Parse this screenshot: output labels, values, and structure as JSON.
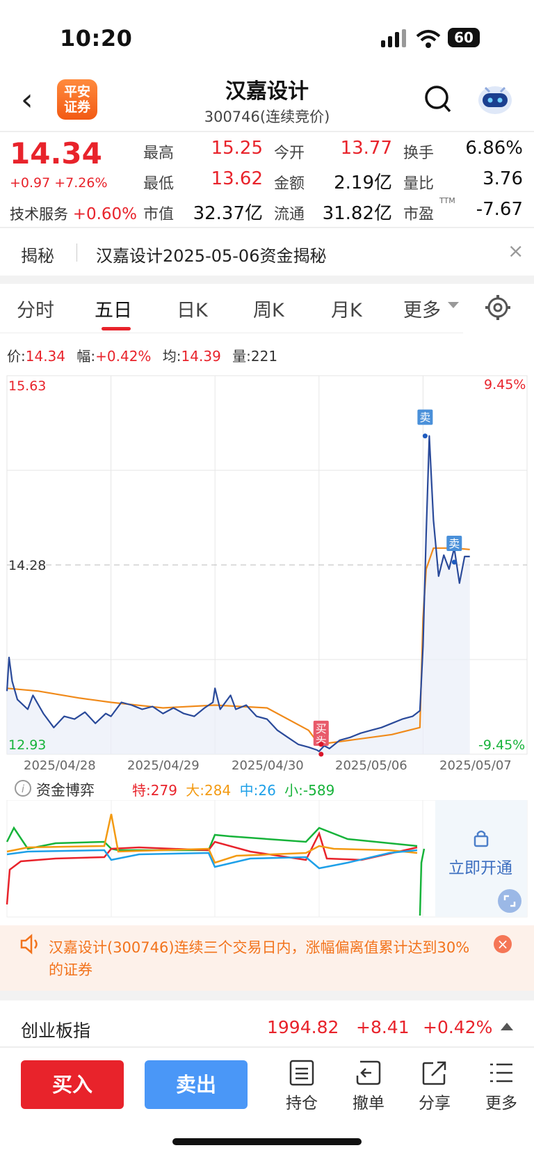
{
  "status_bar": {
    "time": "10:20",
    "battery": "60"
  },
  "header": {
    "title": "汉嘉设计",
    "subtitle": "300746(连续竞价)",
    "logo_text_1": "平安",
    "logo_text_2": "证券"
  },
  "quote": {
    "price": "14.34",
    "change": "+0.97 +7.26%",
    "industry_label": "技术服务",
    "industry_change": "+0.60%",
    "fields": [
      {
        "label": "最高",
        "value": "15.25",
        "color": "red"
      },
      {
        "label": "今开",
        "value": "13.77",
        "color": "red"
      },
      {
        "label": "换手",
        "value": "6.86%",
        "color": "black"
      },
      {
        "label": "最低",
        "value": "13.62",
        "color": "red"
      },
      {
        "label": "金额",
        "value": "2.19亿",
        "color": "black"
      },
      {
        "label": "量比",
        "value": "3.76",
        "color": "black"
      },
      {
        "label": "市值",
        "value": "32.37亿",
        "color": "black"
      },
      {
        "label": "流通",
        "value": "31.82亿",
        "color": "black"
      },
      {
        "label": "市盈",
        "value": "-7.67",
        "color": "black",
        "sup": "TTM"
      }
    ]
  },
  "news": {
    "tag": "揭秘",
    "text": "汉嘉设计2025-05-06资金揭秘"
  },
  "tabs": [
    "分时",
    "五日",
    "日K",
    "周K",
    "月K",
    "更多"
  ],
  "active_tab": "五日",
  "legend": {
    "price_label": "价:",
    "price_value": "14.34",
    "amp_label": "幅:",
    "amp_value": "+0.42%",
    "avg_label": "均:",
    "avg_value": "14.39",
    "vol_label": "量:",
    "vol_value": "221"
  },
  "chart_data": {
    "type": "line",
    "y_top": "15.63",
    "y_mid": "14.28",
    "y_bottom": "12.93",
    "pct_top": "9.45%",
    "pct_bottom": "-9.45%",
    "ylim": [
      12.93,
      15.63
    ],
    "dates": [
      "2025/04/28",
      "2025/04/29",
      "2025/04/30",
      "2025/05/06",
      "2025/05/07"
    ],
    "markers": [
      {
        "label": "卖",
        "type": "sell",
        "day": 4,
        "t": 0.02,
        "price": 15.2
      },
      {
        "label": "卖",
        "type": "sell",
        "day": 4,
        "t": 0.3,
        "price": 14.3
      },
      {
        "label": "买",
        "type": "buy",
        "day": 3,
        "t": 0.02,
        "price": 12.93
      },
      {
        "label": "买",
        "type": "buy",
        "day": 3,
        "t": 0.02,
        "price": 13.0
      }
    ],
    "series": [
      {
        "name": "价格",
        "color": "#2a4a9a",
        "points": [
          [
            0,
            13.38
          ],
          [
            0.02,
            13.62
          ],
          [
            0.05,
            13.45
          ],
          [
            0.1,
            13.32
          ],
          [
            0.2,
            13.25
          ],
          [
            0.25,
            13.35
          ],
          [
            0.35,
            13.22
          ],
          [
            0.45,
            13.12
          ],
          [
            0.55,
            13.2
          ],
          [
            0.65,
            13.18
          ],
          [
            0.75,
            13.23
          ],
          [
            0.85,
            13.15
          ],
          [
            0.95,
            13.22
          ],
          [
            1.0,
            13.2
          ],
          [
            1.1,
            13.3
          ],
          [
            1.2,
            13.28
          ],
          [
            1.3,
            13.25
          ],
          [
            1.4,
            13.27
          ],
          [
            1.5,
            13.22
          ],
          [
            1.6,
            13.26
          ],
          [
            1.7,
            13.22
          ],
          [
            1.8,
            13.2
          ],
          [
            1.9,
            13.26
          ],
          [
            1.98,
            13.3
          ],
          [
            2.0,
            13.4
          ],
          [
            2.05,
            13.25
          ],
          [
            2.15,
            13.35
          ],
          [
            2.2,
            13.25
          ],
          [
            2.3,
            13.28
          ],
          [
            2.4,
            13.2
          ],
          [
            2.5,
            13.18
          ],
          [
            2.6,
            13.1
          ],
          [
            2.7,
            13.05
          ],
          [
            2.8,
            13.0
          ],
          [
            2.9,
            12.98
          ],
          [
            2.98,
            12.96
          ],
          [
            3.0,
            12.95
          ],
          [
            3.05,
            12.99
          ],
          [
            3.1,
            12.97
          ],
          [
            3.2,
            13.03
          ],
          [
            3.3,
            13.05
          ],
          [
            3.4,
            13.08
          ],
          [
            3.5,
            13.1
          ],
          [
            3.6,
            13.12
          ],
          [
            3.7,
            13.15
          ],
          [
            3.8,
            13.18
          ],
          [
            3.9,
            13.2
          ],
          [
            3.97,
            13.24
          ],
          [
            4.0,
            13.7
          ],
          [
            4.03,
            14.5
          ],
          [
            4.06,
            15.2
          ],
          [
            4.1,
            14.6
          ],
          [
            4.15,
            14.2
          ],
          [
            4.2,
            14.35
          ],
          [
            4.25,
            14.25
          ],
          [
            4.3,
            14.4
          ],
          [
            4.35,
            14.15
          ],
          [
            4.4,
            14.34
          ],
          [
            4.45,
            14.34
          ]
        ]
      },
      {
        "name": "均价",
        "color": "#f08a1a",
        "points": [
          [
            0,
            13.4
          ],
          [
            0.3,
            13.38
          ],
          [
            0.7,
            13.33
          ],
          [
            1.0,
            13.3
          ],
          [
            1.5,
            13.26
          ],
          [
            2.0,
            13.28
          ],
          [
            2.5,
            13.26
          ],
          [
            2.9,
            13.1
          ],
          [
            3.0,
            13.0
          ],
          [
            3.3,
            13.03
          ],
          [
            3.7,
            13.07
          ],
          [
            3.97,
            13.12
          ],
          [
            4.0,
            13.9
          ],
          [
            4.03,
            14.25
          ],
          [
            4.1,
            14.4
          ],
          [
            4.3,
            14.4
          ],
          [
            4.45,
            14.39
          ]
        ]
      }
    ]
  },
  "money_flow": {
    "title": "资金博弈",
    "items": [
      {
        "label": "特:",
        "value": "279",
        "color": "#e8232b"
      },
      {
        "label": "大:",
        "value": "284",
        "color": "#f39a12"
      },
      {
        "label": "中:",
        "value": "26",
        "color": "#1ea0e8"
      },
      {
        "label": "小:",
        "value": "-589",
        "color": "#17b33a"
      }
    ],
    "unlock_text": "立即开通"
  },
  "alert": {
    "text": "汉嘉设计(300746)连续三个交易日内，涨幅偏离值累计达到30%的证券"
  },
  "index": {
    "name": "创业板指",
    "value": "1994.82",
    "change": "+8.41",
    "percent": "+0.42%"
  },
  "bottom_bar": {
    "buy": "买入",
    "sell": "卖出",
    "tools": [
      {
        "label": "持仓",
        "icon": "doc-icon"
      },
      {
        "label": "撤单",
        "icon": "undo-icon"
      },
      {
        "label": "分享",
        "icon": "share-icon"
      },
      {
        "label": "更多",
        "icon": "menu-icon"
      }
    ]
  }
}
